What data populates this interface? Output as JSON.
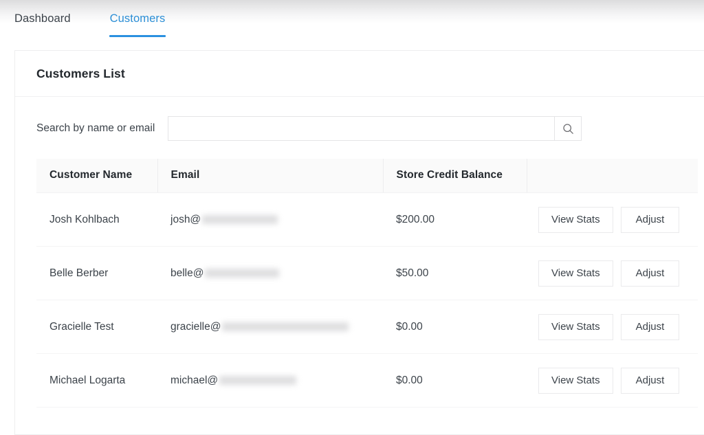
{
  "nav": {
    "tabs": [
      {
        "label": "Dashboard",
        "active": false
      },
      {
        "label": "Customers",
        "active": true
      }
    ],
    "accent_color": "#2a90e0"
  },
  "card": {
    "title": "Customers List"
  },
  "search": {
    "label": "Search by name or email",
    "value": "",
    "placeholder": "",
    "icon": "search-icon"
  },
  "table": {
    "columns": [
      "Customer Name",
      "Email",
      "Store Credit Balance",
      ""
    ],
    "rows": [
      {
        "name": "Josh Kohlbach",
        "email_prefix": "josh@",
        "email_redacted_width": 110,
        "credit": "$200.00",
        "view_label": "View Stats",
        "adjust_label": "Adjust"
      },
      {
        "name": "Belle Berber",
        "email_prefix": "belle@",
        "email_redacted_width": 108,
        "credit": "$50.00",
        "view_label": "View Stats",
        "adjust_label": "Adjust"
      },
      {
        "name": "Gracielle Test",
        "email_prefix": "gracielle@",
        "email_redacted_width": 184,
        "credit": "$0.00",
        "view_label": "View Stats",
        "adjust_label": "Adjust"
      },
      {
        "name": "Michael Logarta",
        "email_prefix": "michael@",
        "email_redacted_width": 112,
        "credit": "$0.00",
        "view_label": "View Stats",
        "adjust_label": "Adjust"
      }
    ]
  }
}
